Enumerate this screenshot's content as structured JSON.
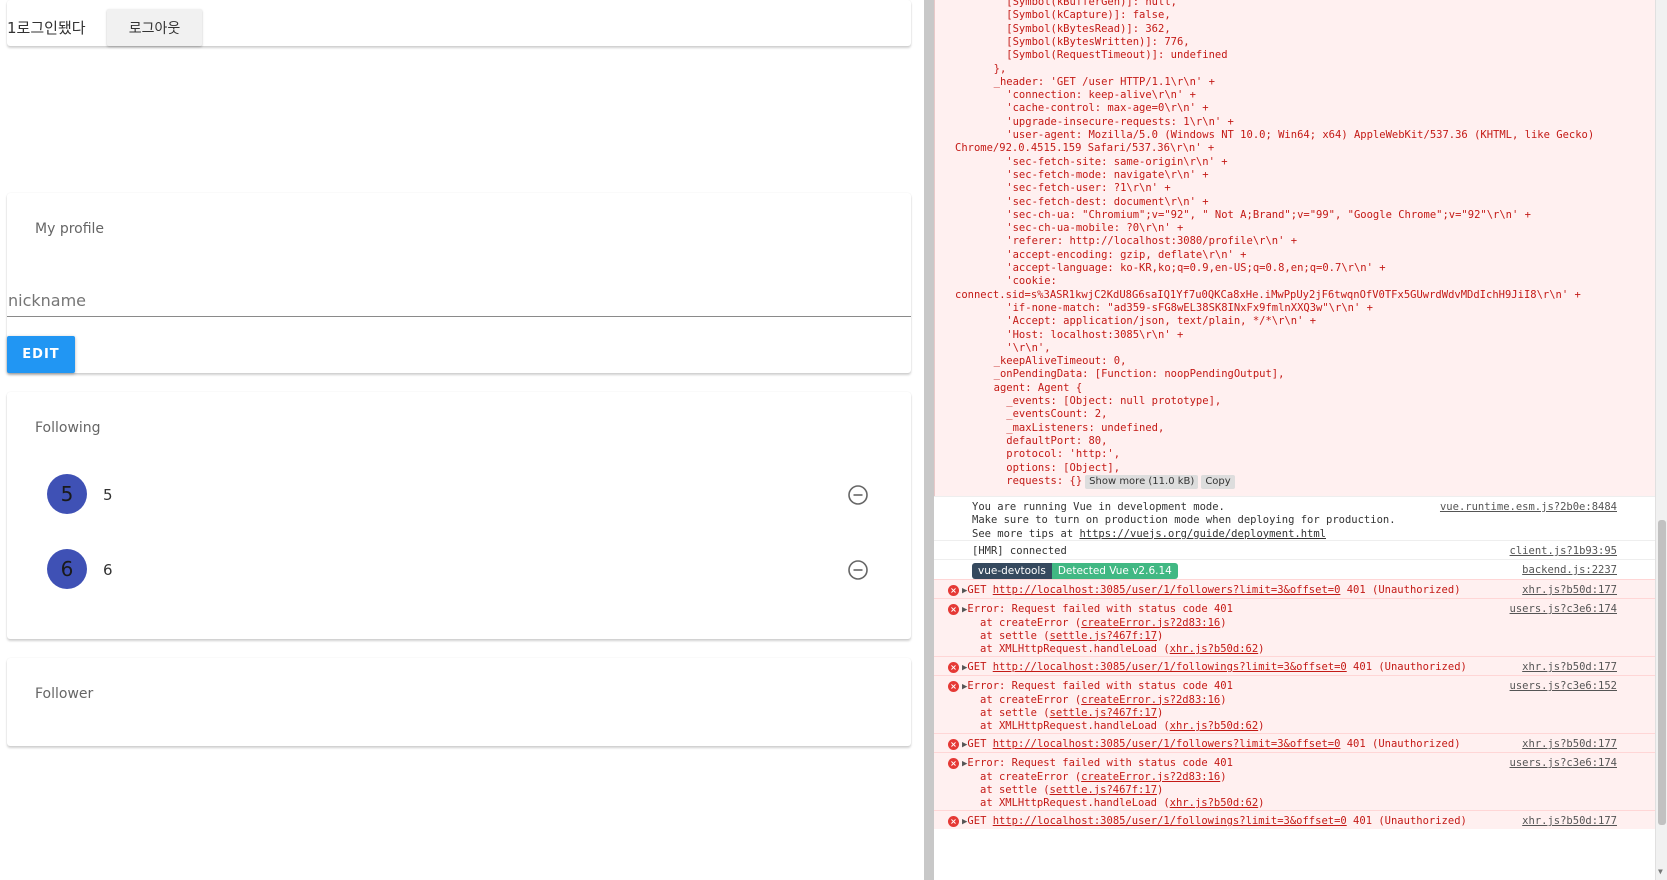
{
  "app": {
    "login_text": "1로그인됐다",
    "logout_label": "로그아웃",
    "profile": {
      "title": "My profile",
      "nickname_placeholder": "nickname",
      "edit_label": "EDIT"
    },
    "following": {
      "title": "Following",
      "items": [
        {
          "avatar": "5",
          "label": "5"
        },
        {
          "avatar": "6",
          "label": "6"
        }
      ],
      "remove_icon": "minus-circle-icon"
    },
    "follower": {
      "title": "Follower"
    },
    "colors": {
      "primary": "#2196f3",
      "avatar": "#3f51b5"
    }
  },
  "console": {
    "object_lines": [
      "    [Symbol(kBufferGen)]: null,",
      "    [Symbol(kCapture)]: false,",
      "    [Symbol(kBytesRead)]: 362,",
      "    [Symbol(kBytesWritten)]: 776,",
      "    [Symbol(RequestTimeout)]: undefined",
      "  },",
      "  _header: 'GET /user HTTP/1.1\\r\\n' +",
      "    'connection: keep-alive\\r\\n' +",
      "    'cache-control: max-age=0\\r\\n' +",
      "    'upgrade-insecure-requests: 1\\r\\n' +",
      "    'user-agent: Mozilla/5.0 (Windows NT 10.0; Win64; x64) AppleWebKit/537.36 (KHTML, like Gecko)",
      "Chrome/92.0.4515.159 Safari/537.36\\r\\n' +",
      "    'sec-fetch-site: same-origin\\r\\n' +",
      "    'sec-fetch-mode: navigate\\r\\n' +",
      "    'sec-fetch-user: ?1\\r\\n' +",
      "    'sec-fetch-dest: document\\r\\n' +",
      "    'sec-ch-ua: \"Chromium\";v=\"92\", \" Not A;Brand\";v=\"99\", \"Google Chrome\";v=\"92\"\\r\\n' +",
      "    'sec-ch-ua-mobile: ?0\\r\\n' +",
      "    'referer: http://localhost:3080/profile\\r\\n' +",
      "    'accept-encoding: gzip, deflate\\r\\n' +",
      "    'accept-language: ko-KR,ko;q=0.9,en-US;q=0.8,en;q=0.7\\r\\n' +",
      "    'cookie:",
      "connect.sid=s%3ASR1kwjC2KdU8G6saIQ1Yf7u0QKCa8xHe.iMwPpUy2jF6twqnOfV0TFx5GUwrdWdvMDdIchH9JiI8\\r\\n' +",
      "    'if-none-match: \"ad359-sFG8wEL38SK8INxFx9fmlnXXQ3w\"\\r\\n' +",
      "    'Accept: application/json, text/plain, */*\\r\\n' +",
      "    'Host: localhost:3085\\r\\n' +",
      "    '\\r\\n',",
      "  _keepAliveTimeout: 0,",
      "  _onPendingData: [Function: noopPendingOutput],",
      "  agent: Agent {",
      "    _events: [Object: null prototype],",
      "    _eventsCount: 2,",
      "    _maxListeners: undefined,",
      "    defaultPort: 80,",
      "    protocol: 'http:',",
      "    options: [Object],",
      "    requests: {}"
    ],
    "show_more": "Show more (11.0 kB)",
    "copy": "Copy",
    "vue_dev_lines": [
      "You are running Vue in development mode.",
      "Make sure to turn on production mode when deploying for production.",
      "See more tips at "
    ],
    "vue_dev_link": "https://vuejs.org/guide/deployment.html",
    "vue_dev_src": "vue.runtime.esm.js?2b0e:8484",
    "hmr_text": "[HMR] connected",
    "hmr_src": "client.js?1b93:95",
    "devtools_badge": "vue-devtools",
    "devtools_version": "Detected Vue v2.6.14",
    "devtools_src": "backend.js:2237",
    "errors": [
      {
        "kind": "get",
        "prefix": "GET ",
        "url": "http://localhost:3085/user/1/followers?limit=3&offset=0",
        "suffix": " 401 (Unauthorized)",
        "src": "xhr.js?b50d:177"
      },
      {
        "kind": "stack",
        "msg": "Error: Request failed with status code 401",
        "src": "users.js?c3e6:174",
        "stack": [
          [
            "at createError (",
            "createError.js?2d83:16",
            ")"
          ],
          [
            "at settle (",
            "settle.js?467f:17",
            ")"
          ],
          [
            "at XMLHttpRequest.handleLoad (",
            "xhr.js?b50d:62",
            ")"
          ]
        ]
      },
      {
        "kind": "get",
        "prefix": "GET ",
        "url": "http://localhost:3085/user/1/followings?limit=3&offset=0",
        "suffix": " 401 (Unauthorized)",
        "src": "xhr.js?b50d:177"
      },
      {
        "kind": "stack",
        "msg": "Error: Request failed with status code 401",
        "src": "users.js?c3e6:152",
        "stack": [
          [
            "at createError (",
            "createError.js?2d83:16",
            ")"
          ],
          [
            "at settle (",
            "settle.js?467f:17",
            ")"
          ],
          [
            "at XMLHttpRequest.handleLoad (",
            "xhr.js?b50d:62",
            ")"
          ]
        ]
      },
      {
        "kind": "get",
        "prefix": "GET ",
        "url": "http://localhost:3085/user/1/followers?limit=3&offset=0",
        "suffix": " 401 (Unauthorized)",
        "src": "xhr.js?b50d:177"
      },
      {
        "kind": "stack",
        "msg": "Error: Request failed with status code 401",
        "src": "users.js?c3e6:174",
        "stack": [
          [
            "at createError (",
            "createError.js?2d83:16",
            ")"
          ],
          [
            "at settle (",
            "settle.js?467f:17",
            ")"
          ],
          [
            "at XMLHttpRequest.handleLoad (",
            "xhr.js?b50d:62",
            ")"
          ]
        ]
      },
      {
        "kind": "get",
        "prefix": "GET ",
        "url": "http://localhost:3085/user/1/followings?limit=3&offset=0",
        "suffix": " 401 (Unauthorized)",
        "src": "xhr.js?b50d:177"
      }
    ]
  }
}
